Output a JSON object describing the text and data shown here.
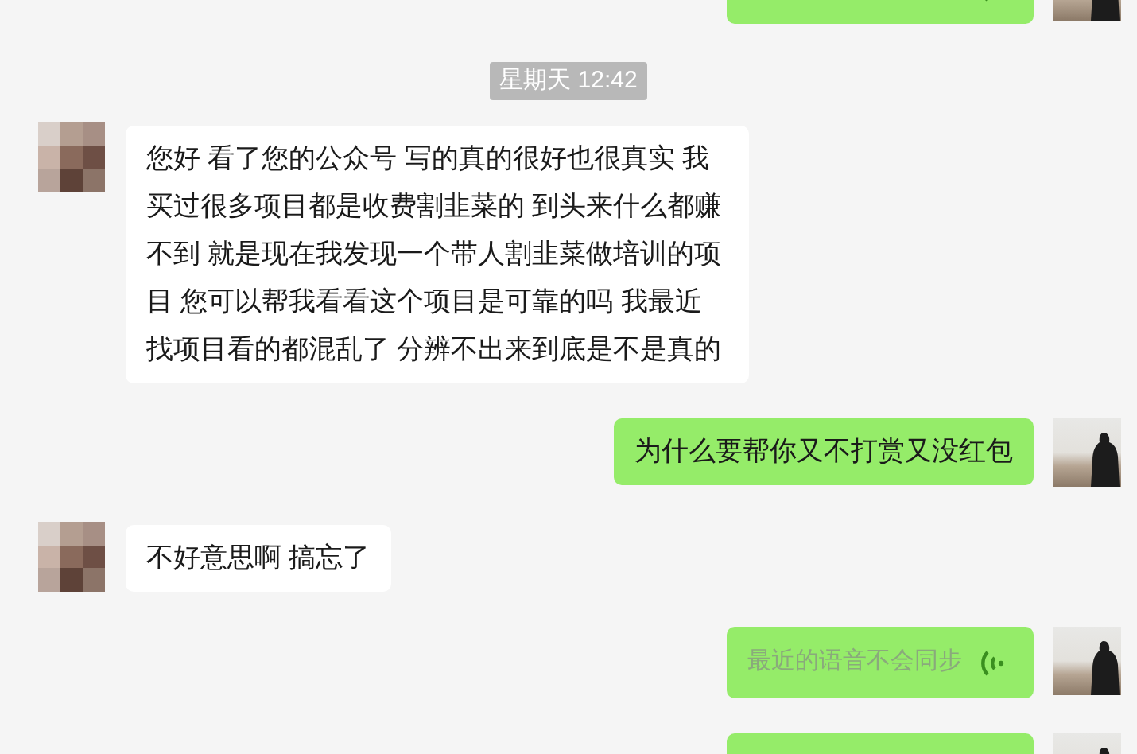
{
  "messages": [
    {
      "kind": "voice",
      "sent": true
    },
    {
      "kind": "time",
      "text": "星期天 12:42"
    },
    {
      "kind": "text",
      "sent": false,
      "text": "您好 看了您的公众号 写的真的很好也很真实 我买过很多项目都是收费割韭菜的 到头来什么都赚不到 就是现在我发现一个带人割韭菜做培训的项目 您可以帮我看看这个项目是可靠的吗 我最近找项目看的都混乱了 分辨不出来到底是不是真的"
    },
    {
      "kind": "text",
      "sent": true,
      "text": "为什么要帮你又不打赏又没红包"
    },
    {
      "kind": "text",
      "sent": false,
      "text": "不好意思啊 搞忘了"
    },
    {
      "kind": "voice",
      "sent": true,
      "text": "最近的语音不会同步"
    },
    {
      "kind": "voice",
      "sent": true
    }
  ]
}
